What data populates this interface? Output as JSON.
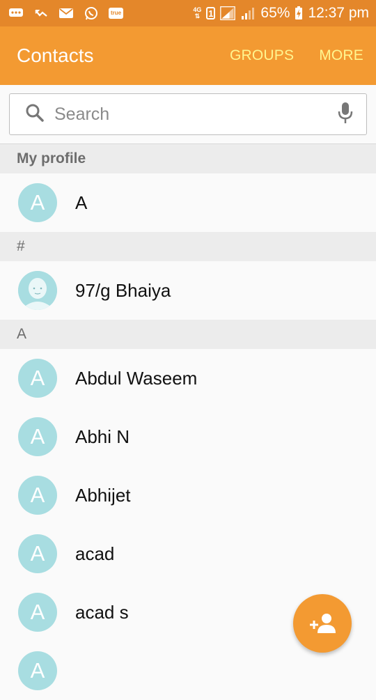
{
  "status_bar": {
    "carrier_badge": "true",
    "network": "4G",
    "sim": "1",
    "battery": "65%",
    "time": "12:37 pm"
  },
  "appbar": {
    "title": "Contacts",
    "groups_label": "GROUPS",
    "more_label": "MORE"
  },
  "search": {
    "placeholder": "Search"
  },
  "my_profile": {
    "header": "My profile",
    "initial": "A",
    "name": "A"
  },
  "sections": [
    {
      "header": "#",
      "contacts": [
        {
          "name": "97/g Bhaiya",
          "avatar": "face-icon"
        }
      ]
    },
    {
      "header": "A",
      "contacts": [
        {
          "name": "Abdul Waseem",
          "initial": "A"
        },
        {
          "name": "Abhi N",
          "initial": "A"
        },
        {
          "name": "Abhijet",
          "initial": "A"
        },
        {
          "name": "acad",
          "initial": "A"
        },
        {
          "name": "acad s",
          "initial": "A"
        },
        {
          "name": "",
          "initial": "A"
        }
      ]
    }
  ],
  "colors": {
    "status_bar": "#e4872a",
    "app_bar": "#f39a32",
    "action_text": "#fff58f",
    "avatar": "#a8dde1",
    "fab": "#f39a32"
  }
}
